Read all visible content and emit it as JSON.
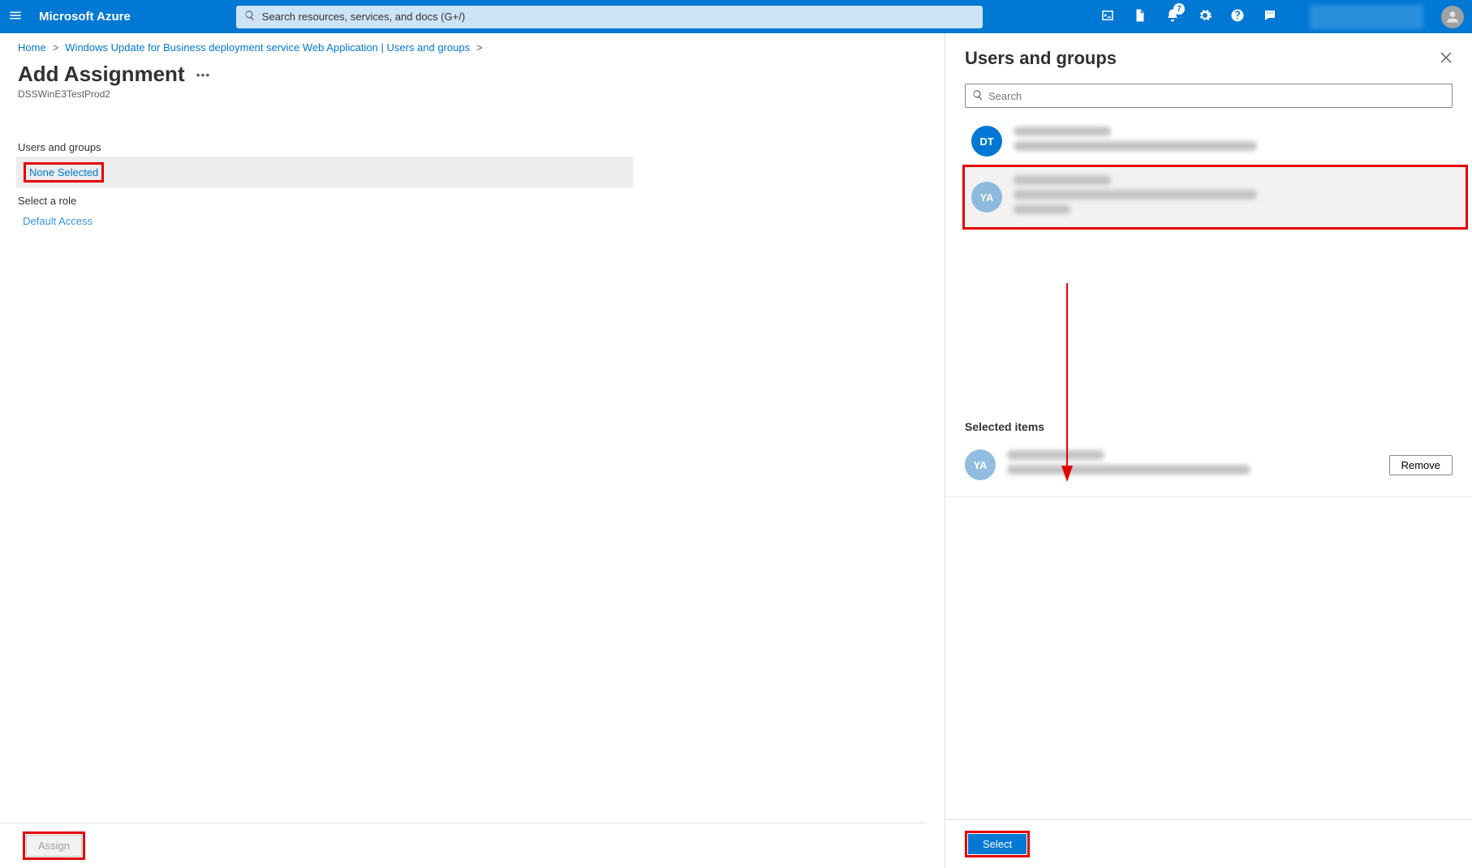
{
  "topbar": {
    "brand": "Microsoft Azure",
    "search_placeholder": "Search resources, services, and docs (G+/)",
    "notification_count": "7"
  },
  "breadcrumb": {
    "home": "Home",
    "app": "Windows Update for Business deployment service Web Application | Users and groups"
  },
  "page": {
    "title": "Add Assignment",
    "subtitle": "DSSWinE3TestProd2"
  },
  "form": {
    "users_label": "Users and groups",
    "users_value": "None Selected",
    "role_label": "Select a role",
    "role_value": "Default Access"
  },
  "buttons": {
    "assign": "Assign",
    "select": "Select",
    "remove": "Remove"
  },
  "flyout": {
    "title": "Users and groups",
    "search_placeholder": "Search",
    "selected_label": "Selected items",
    "users": [
      {
        "initials": "DT",
        "avatar_class": "dt"
      },
      {
        "initials": "YA",
        "avatar_class": "ya"
      }
    ],
    "selected": [
      {
        "initials": "YA",
        "avatar_class": "ya"
      }
    ]
  }
}
